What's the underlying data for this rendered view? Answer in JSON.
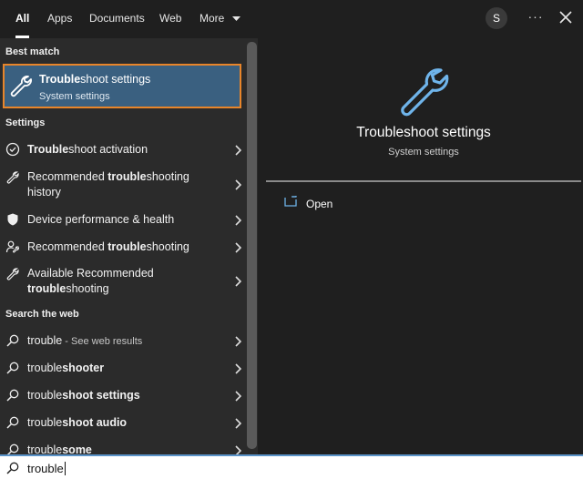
{
  "tabs": [
    {
      "label": "All",
      "active": true
    },
    {
      "label": "Apps"
    },
    {
      "label": "Documents"
    },
    {
      "label": "Web"
    },
    {
      "label": "More"
    }
  ],
  "account_initial": "S",
  "more_dots": "···",
  "sections": {
    "best_match": "Best match",
    "settings": "Settings",
    "web": "Search the web"
  },
  "best_match": {
    "title_bold": "Trouble",
    "title_rest": "shoot settings",
    "subtitle": "System settings",
    "icon": "wrench-icon"
  },
  "settings_items": [
    {
      "pre": "",
      "bold": "Trouble",
      "post": "shoot activation",
      "icon": "check-circle-icon"
    },
    {
      "pre": "Recommended ",
      "bold": "trouble",
      "post": "shooting",
      "line2": "history",
      "icon": "wrench-icon"
    },
    {
      "pre": "Device performance & health",
      "bold": "",
      "post": "",
      "icon": "shield-icon"
    },
    {
      "pre": "Recommended ",
      "bold": "trouble",
      "post": "shooting",
      "icon": "person-wrench-icon"
    },
    {
      "pre": "Available Recommended",
      "bold": "",
      "post": "",
      "line2_bold": "trouble",
      "line2_post": "shooting",
      "icon": "wrench-icon"
    }
  ],
  "web_items": [
    {
      "pre": "trouble",
      "bold": "",
      "hint": " - See web results"
    },
    {
      "pre": "trouble",
      "bold": "shooter"
    },
    {
      "pre": "trouble",
      "bold": "shoot settings"
    },
    {
      "pre": "trouble",
      "bold": "shoot audio"
    },
    {
      "pre": "trouble",
      "bold": "some"
    }
  ],
  "detail": {
    "title": "Troubleshoot settings",
    "subtitle": "System settings",
    "open_label": "Open",
    "accent": "#6fb4ea"
  },
  "search": {
    "value": "trouble"
  }
}
